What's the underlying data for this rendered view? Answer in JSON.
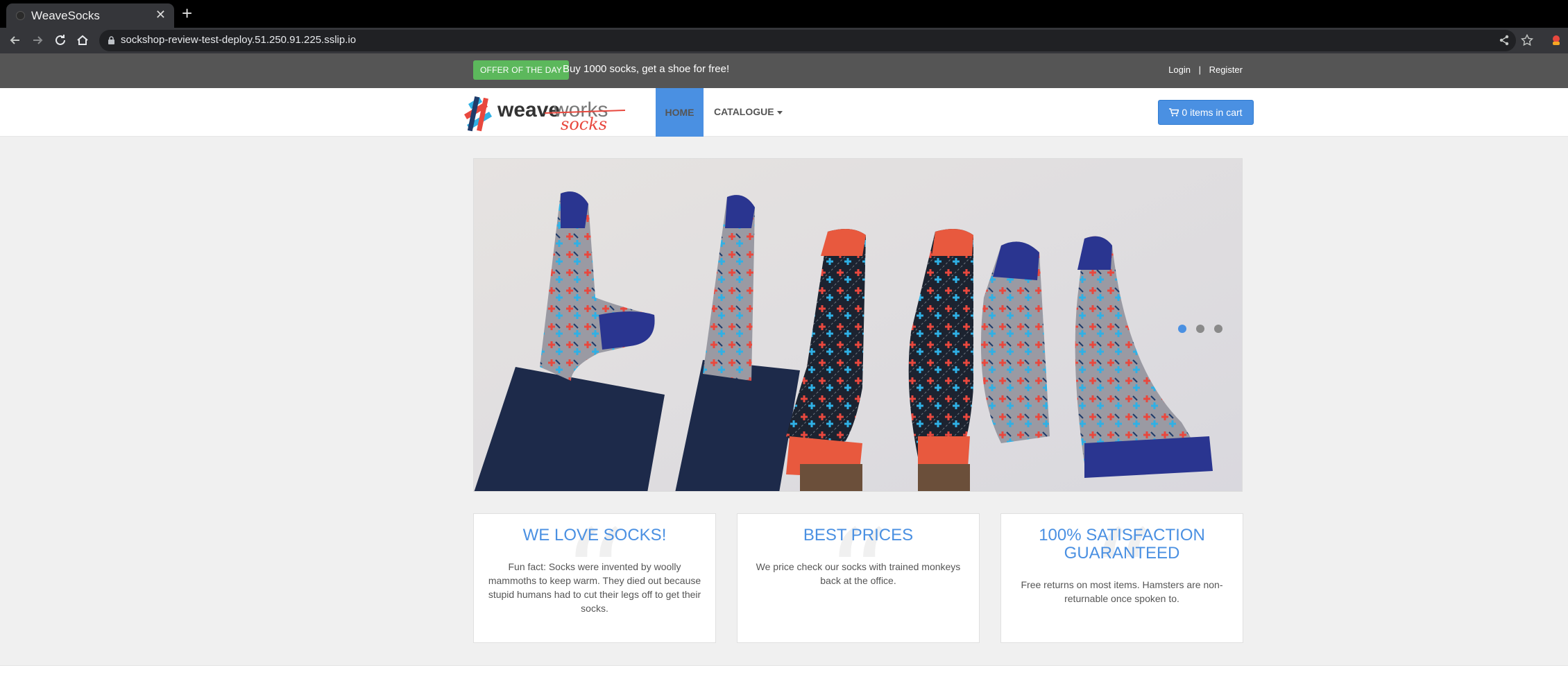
{
  "browser": {
    "tab_title": "WeaveSocks",
    "url": "sockshop-review-test-deploy.51.250.91.225.sslip.io"
  },
  "topbar": {
    "offer_badge": "OFFER OF THE DAY",
    "offer_text": "Buy 1000 socks, get a shoe for free!",
    "login": "Login",
    "separator": "|",
    "register": "Register"
  },
  "navbar": {
    "logo_text_1": "weave",
    "logo_text_2": "works",
    "logo_text_3": "socks",
    "home": "HOME",
    "catalogue": "CATALOGUE",
    "cart": "0 items in cart"
  },
  "carousel": {
    "slide_count": 3,
    "active_slide": 1
  },
  "boxes": [
    {
      "title": "WE LOVE SOCKS!",
      "text": "Fun fact: Socks were invented by woolly mammoths to keep warm. They died out because stupid humans had to cut their legs off to get their socks."
    },
    {
      "title": "BEST PRICES",
      "text": "We price check our socks with trained monkeys back at the office."
    },
    {
      "title": "100% SATISFACTION GUARANTEED",
      "text": "Free returns on most items. Hamsters are non-returnable once spoken to."
    }
  ],
  "colors": {
    "accent": "#4a90e2",
    "offer_green": "#5cb85c",
    "topbar": "#555555",
    "content_bg": "#f0f0f0"
  }
}
